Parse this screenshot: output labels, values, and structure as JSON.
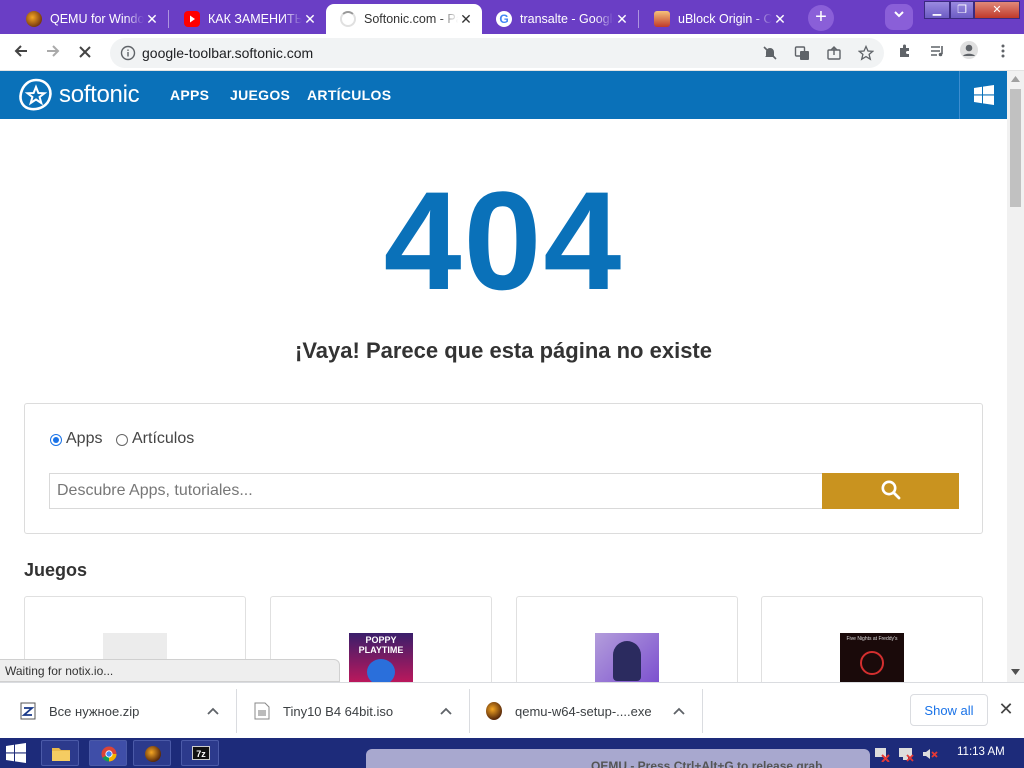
{
  "tabs": [
    {
      "title": "QEMU for Windows",
      "favicon": "qemu-icon",
      "active": false
    },
    {
      "title": "КАК ЗАМЕНИТЬ HDD",
      "favicon": "youtube-icon",
      "active": false
    },
    {
      "title": "Softonic.com - Página",
      "favicon": "loading-spinner-icon",
      "active": true
    },
    {
      "title": "transalte - Google Search",
      "favicon": "google-icon",
      "active": false
    },
    {
      "title": "uBlock Origin - Chrome",
      "favicon": "ublock-icon",
      "active": false
    }
  ],
  "toolbar": {
    "url": "google-toolbar.softonic.com"
  },
  "site": {
    "logo": "softonic",
    "nav": [
      "APPS",
      "JUEGOS",
      "ARTÍCULOS"
    ],
    "error_code": "404",
    "error_message": "¡Vaya! Parece que esta página no existe",
    "search": {
      "options": [
        "Apps",
        "Artículos"
      ],
      "selected": "Apps",
      "placeholder": "Descubre Apps, tutoriales..."
    },
    "section_title": "Juegos",
    "games": [
      {
        "thumb": "blank-thumbnail"
      },
      {
        "thumb": "poppy-playtime-thumbnail",
        "thumb_text": "POPPY PLAYTIME"
      },
      {
        "thumb": "anime-avatar-thumbnail"
      },
      {
        "thumb": "fnaf-thumbnail",
        "thumb_text": "Five Nights at Freddy's"
      }
    ]
  },
  "status_text": "Waiting for notix.io...",
  "downloads": [
    {
      "name": "Все нужное.zip",
      "icon": "zip-file-icon"
    },
    {
      "name": "Tiny10 B4 64bit.iso",
      "icon": "iso-file-icon"
    },
    {
      "name": "qemu-w64-setup-....exe",
      "icon": "qemu-icon"
    }
  ],
  "show_all": "Show all",
  "taskbar": {
    "clock": "11:13 AM",
    "notification": "QEMU - Press Ctrl+Alt+G to release grab"
  },
  "colors": {
    "browser_frame": "#6a3ec5",
    "site_header": "#0a71b9",
    "search_button": "#c9931f",
    "taskbar": "#1d2b7a"
  }
}
